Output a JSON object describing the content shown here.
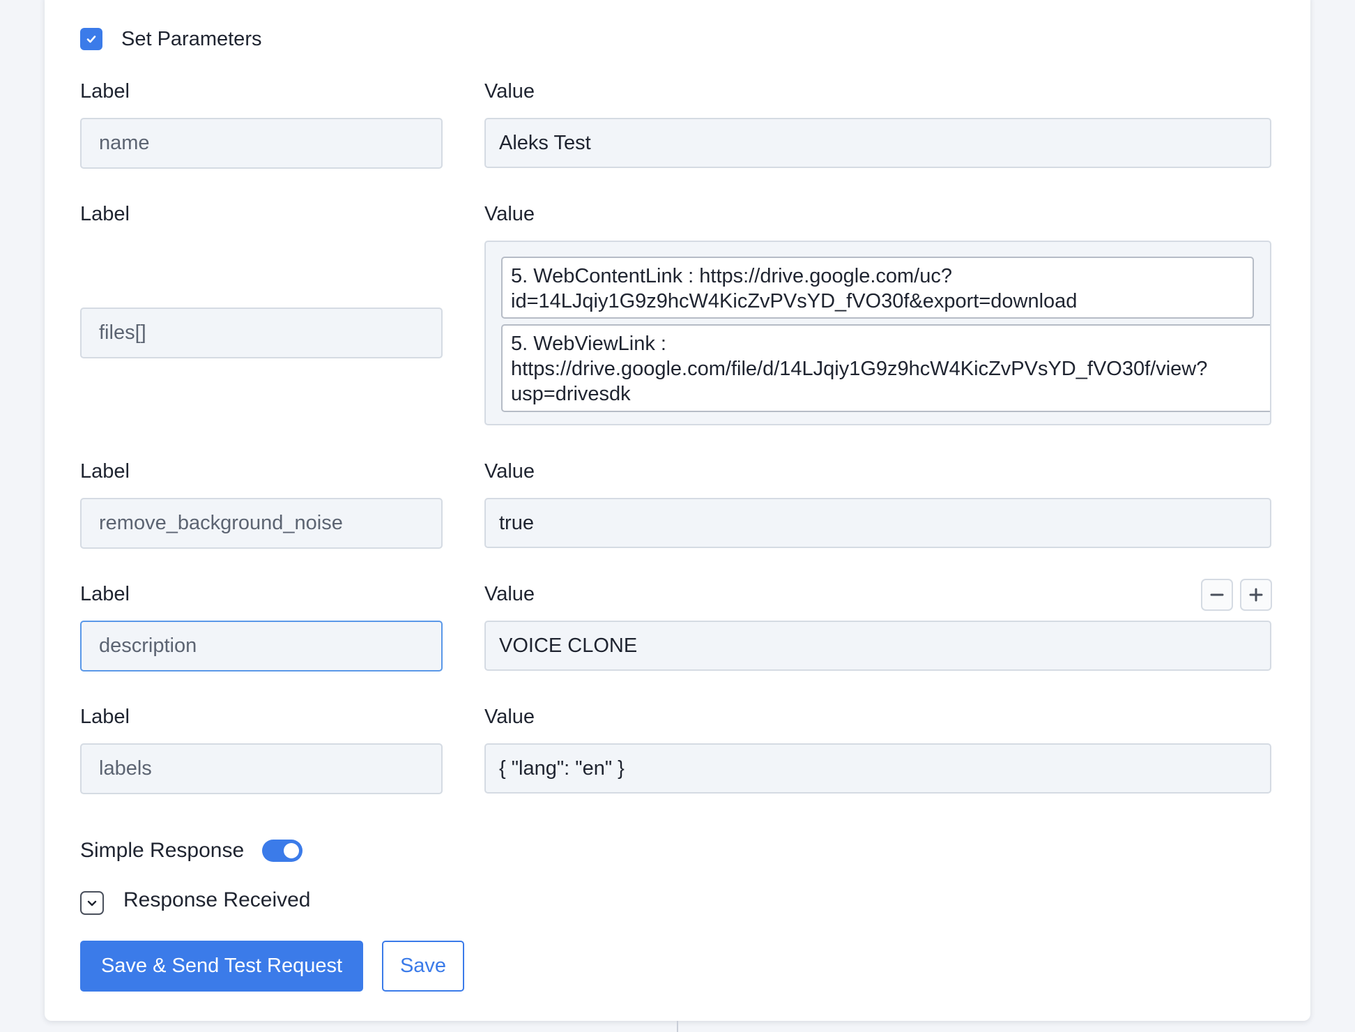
{
  "section": {
    "title": "Set Parameters",
    "enabled": true
  },
  "params": [
    {
      "label_heading": "Label",
      "value_heading": "Value",
      "label": "name",
      "value": "Aleks Test"
    },
    {
      "label_heading": "Label",
      "value_heading": "Value",
      "label": "files[]",
      "values": [
        {
          "lines": [
            "5. WebContentLink : https://drive.google.com/uc?",
            "id=14LJqiy1G9z9hcW4KicZvPVsYD_fVO30f&export=download"
          ]
        },
        {
          "lines": [
            "5. WebViewLink :",
            "https://drive.google.com/file/d/14LJqiy1G9z9hcW4KicZvPVsYD_fVO30f/view?",
            "usp=drivesdk"
          ]
        }
      ]
    },
    {
      "label_heading": "Label",
      "value_heading": "Value",
      "label": "remove_background_noise",
      "value": "true"
    },
    {
      "label_heading": "Label",
      "value_heading": "Value",
      "label": "description",
      "value": "VOICE CLONE"
    },
    {
      "label_heading": "Label",
      "value_heading": "Value",
      "label": "labels",
      "value": "{ \"lang\": \"en\" }"
    }
  ],
  "row_controls": {
    "remove_icon": "minus-icon",
    "add_icon": "plus-icon"
  },
  "simple_response": {
    "label": "Simple Response",
    "on": true
  },
  "response_received": {
    "label": "Response Received",
    "icon": "chevron-down-icon"
  },
  "buttons": {
    "primary": "Save & Send Test Request",
    "secondary": "Save"
  },
  "colors": {
    "accent": "#3b7be9",
    "field_bg": "#f2f5f9",
    "field_border": "#d5dbe3",
    "focus_border": "#5a98e8"
  }
}
